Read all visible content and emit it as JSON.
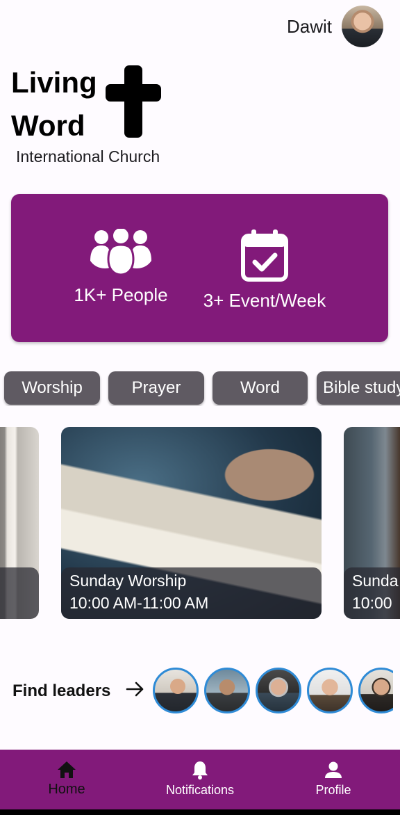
{
  "header": {
    "user_name": "Dawit",
    "avatar_icon": "user-avatar"
  },
  "brand": {
    "title_line1": "Living",
    "title_line2": "Word",
    "subtitle": "International Church",
    "logo_icon": "cross-icon"
  },
  "stats": {
    "accent_color": "#821a7a",
    "people_label": "1K+ People",
    "people_icon": "people-group-icon",
    "events_label": "3+ Event/Week",
    "events_icon": "calendar-check-icon"
  },
  "categories": [
    "Worship",
    "Prayer",
    "Word",
    "Bible study"
  ],
  "events": [
    {
      "title": "",
      "time": ""
    },
    {
      "title": "Sunday Worship",
      "time": "10:00 AM-11:00 AM"
    },
    {
      "title": "Sunda",
      "time": "10:00"
    }
  ],
  "leaders": {
    "label": "Find leaders",
    "arrow_icon": "arrow-right-icon",
    "count_visible": 5
  },
  "bottom_nav": {
    "items": [
      {
        "label": "Home",
        "icon": "home-icon",
        "active": true
      },
      {
        "label": "Notifications",
        "icon": "bell-icon",
        "active": false
      },
      {
        "label": "Profile",
        "icon": "person-icon",
        "active": false
      }
    ]
  }
}
